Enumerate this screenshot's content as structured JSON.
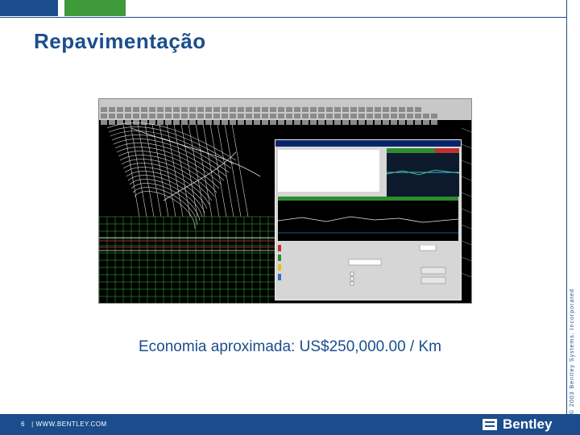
{
  "slide": {
    "title": "Repavimentação",
    "caption": "Economia aproximada: US$250,000.00 / Km",
    "copyright": "© 2003 Bentley Systems, Incorporated"
  },
  "footer": {
    "page_number": "6",
    "separator": "|",
    "website": "WWW.BENTLEY.COM",
    "brand": "Bentley"
  },
  "screenshot": {
    "description_icon": "cad-software-screenshot"
  },
  "colors": {
    "brand_blue": "#1b4d8c",
    "brand_green": "#3f9a3a"
  }
}
